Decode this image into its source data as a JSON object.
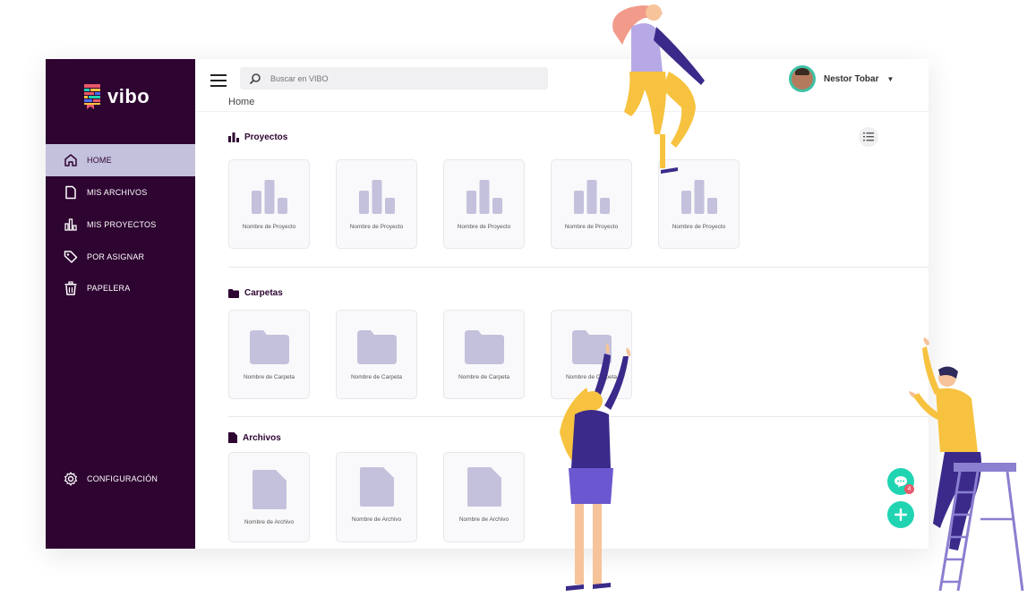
{
  "app": {
    "logo_text": "vibo"
  },
  "sidebar": {
    "items": [
      {
        "label": "HOME",
        "icon": "home-icon",
        "active": true
      },
      {
        "label": "MIS ARCHIVOS",
        "icon": "file-icon"
      },
      {
        "label": "MIS PROYECTOS",
        "icon": "bar-chart-icon"
      },
      {
        "label": "POR ASIGNAR",
        "icon": "tag-icon"
      },
      {
        "label": "PAPELERA",
        "icon": "trash-icon"
      }
    ],
    "settings_label": "CONFIGURACIÓN"
  },
  "header": {
    "search_placeholder": "Buscar en VIBO",
    "breadcrumb": "Home",
    "user_name": "Nestor Tobar",
    "caret": "▼"
  },
  "sections": {
    "projects": {
      "title": "Proyectos",
      "items": [
        "Nombre de Proyecto",
        "Nombre de Proyecto",
        "Nombre de Proyecto",
        "Nombre de Proyecto",
        "Nombre de Proyecto"
      ]
    },
    "folders": {
      "title": "Carpetas",
      "items": [
        "Nombre de Carpeta",
        "Nombre de Carpeta",
        "Nombre de Carpeta",
        "Nombre de Carpeta"
      ]
    },
    "files": {
      "title": "Archivos",
      "items": [
        "Nombre de Archivo",
        "Nombre de Archivo",
        "Nombre de Archivo"
      ]
    }
  },
  "chat": {
    "badge_count": "4"
  },
  "colors": {
    "sidebar_bg": "#2e0431",
    "active_bg": "#c4c1dc",
    "icon_fill": "#c4c1dc",
    "fab": "#20d4b2",
    "badge": "#e8596a"
  }
}
